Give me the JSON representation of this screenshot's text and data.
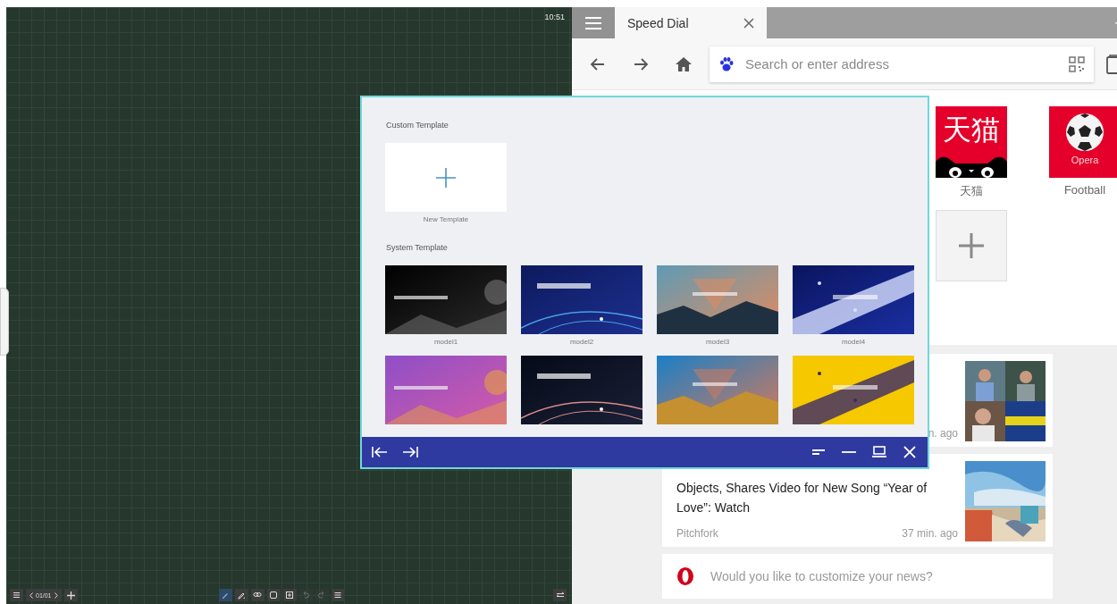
{
  "whiteboard": {
    "clock": "10:51",
    "page": "01/01",
    "tools": [
      {
        "kind": "pen",
        "selected": true,
        "disabled": false
      },
      {
        "kind": "pencil",
        "selected": false,
        "disabled": false
      },
      {
        "kind": "lasso",
        "selected": false,
        "disabled": false
      },
      {
        "kind": "square",
        "selected": false,
        "disabled": false
      },
      {
        "kind": "add",
        "selected": false,
        "disabled": false
      },
      {
        "kind": "undo",
        "selected": false,
        "disabled": true
      },
      {
        "kind": "redo",
        "selected": false,
        "disabled": true
      },
      {
        "kind": "menu",
        "selected": false,
        "disabled": false
      }
    ]
  },
  "browser": {
    "tabs": [
      {
        "label": "Speed Dial",
        "selected": true
      }
    ],
    "address": {
      "placeholder": "Search or enter address"
    },
    "speed_dial": [
      {
        "kind": "tmall",
        "logo_text": "天猫",
        "label": "天猫"
      },
      {
        "kind": "football",
        "logo_text": "Opera",
        "label": "Football"
      },
      {
        "kind": "add"
      }
    ],
    "news": [
      {
        "kind": "article",
        "time": "n. ago"
      },
      {
        "kind": "article",
        "title": "Objects, Shares Video for New Song “Year of Love”: Watch",
        "source": "Pitchfork",
        "time": "37 min. ago"
      },
      {
        "kind": "prompt",
        "text": "Would you like to customize your news?"
      }
    ]
  },
  "template_window": {
    "sections": [
      {
        "title": "Custom Template",
        "items": [
          {
            "kind": "new",
            "caption": "New Template"
          }
        ]
      },
      {
        "title": "System Template",
        "items": [
          {
            "kind": "picture",
            "caption": "model1"
          },
          {
            "kind": "picture",
            "caption": "model2"
          },
          {
            "kind": "picture",
            "caption": "model3"
          },
          {
            "kind": "picture",
            "caption": "model4"
          },
          {
            "kind": "picture"
          },
          {
            "kind": "picture"
          },
          {
            "kind": "picture"
          },
          {
            "kind": "picture"
          }
        ]
      }
    ]
  }
}
